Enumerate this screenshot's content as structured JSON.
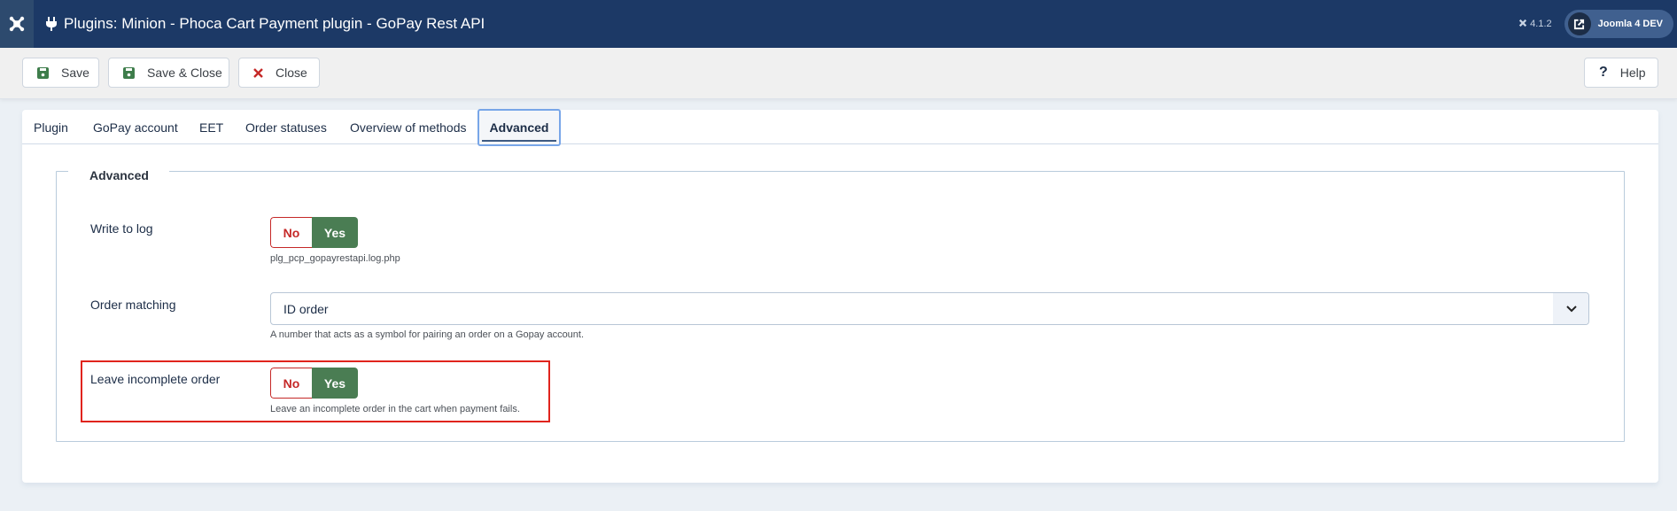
{
  "header": {
    "title": "Plugins: Minion - Phoca Cart Payment plugin - GoPay Rest API",
    "version": "4.1.2",
    "site_button": "Joomla 4 DEV"
  },
  "toolbar": {
    "save_label": "Save",
    "save_close_label": "Save & Close",
    "close_label": "Close",
    "help_label": "Help"
  },
  "tabs": [
    {
      "label": "Plugin",
      "active": false
    },
    {
      "label": "GoPay account",
      "active": false
    },
    {
      "label": "EET",
      "active": false
    },
    {
      "label": "Order statuses",
      "active": false
    },
    {
      "label": "Overview of methods",
      "active": false
    },
    {
      "label": "Advanced",
      "active": true
    }
  ],
  "fieldset": {
    "legend": "Advanced",
    "fields": {
      "write_to_log": {
        "label": "Write to log",
        "options": [
          "No",
          "Yes"
        ],
        "selected": "Yes",
        "hint": "plg_pcp_gopayrestapi.log.php"
      },
      "order_matching": {
        "label": "Order matching",
        "value": "ID order",
        "hint": "A number that acts as a symbol for pairing an order on a Gopay account."
      },
      "leave_incomplete_order": {
        "label": "Leave incomplete order",
        "options": [
          "No",
          "Yes"
        ],
        "selected": "Yes",
        "hint": "Leave an incomplete order in the cart when payment fails.",
        "highlighted": true
      }
    }
  },
  "colors": {
    "header_bg": "#1c3966",
    "yes_active": "#4a7d53",
    "no_border": "#c52827",
    "highlight_border": "#e0241d"
  }
}
